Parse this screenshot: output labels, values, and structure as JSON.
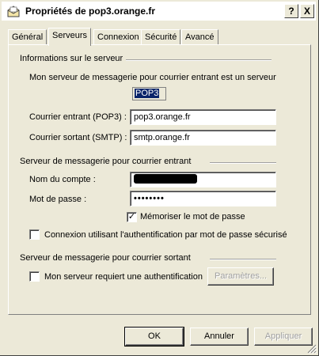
{
  "window": {
    "title": "Propriétés de pop3.orange.fr",
    "help_label": "?",
    "close_label": "X"
  },
  "tabs": [
    {
      "label": "Général"
    },
    {
      "label": "Serveurs",
      "active": true
    },
    {
      "label": "Connexion"
    },
    {
      "label": "Sécurité"
    },
    {
      "label": "Avancé"
    }
  ],
  "server_info": {
    "heading": "Informations sur le serveur",
    "incoming_type_text": "Mon serveur de messagerie pour courrier entrant est un serveur",
    "incoming_type_value": "POP3",
    "incoming_label": "Courrier entrant (POP3) :",
    "incoming_value": "pop3.orange.fr",
    "outgoing_label": "Courrier sortant (SMTP) :",
    "outgoing_value": "smtp.orange.fr"
  },
  "incoming_server": {
    "heading": "Serveur de messagerie pour courrier entrant",
    "account_label": "Nom du compte :",
    "account_value": "",
    "password_label": "Mot de passe :",
    "password_value": "••••••••",
    "remember_label": "Mémoriser le mot de passe",
    "remember_checked": true,
    "spa_label": "Connexion utilisant l'authentification par mot de passe sécurisé",
    "spa_checked": false
  },
  "outgoing_server": {
    "heading": "Serveur de messagerie pour courrier sortant",
    "auth_label": "Mon serveur requiert une authentification",
    "auth_checked": false,
    "settings_button": "Paramètres..."
  },
  "footer": {
    "ok": "OK",
    "cancel": "Annuler",
    "apply": "Appliquer"
  }
}
